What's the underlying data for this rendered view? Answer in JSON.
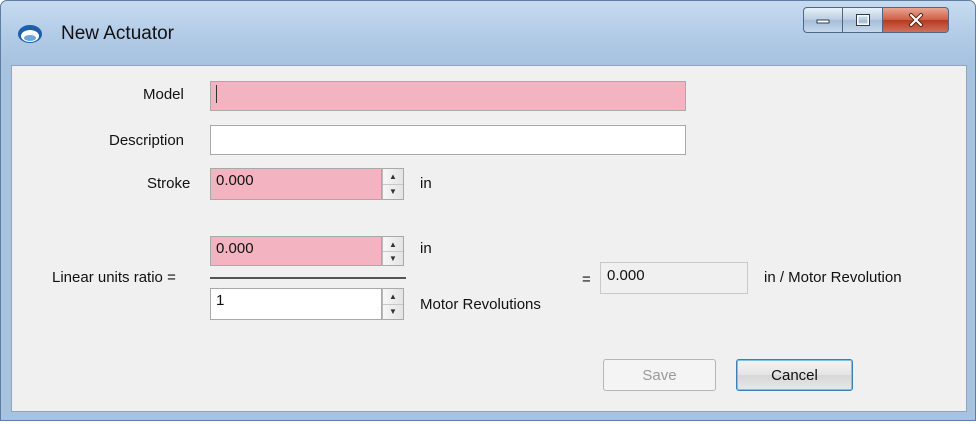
{
  "window": {
    "title": "New Actuator",
    "controls": {
      "minimize": "minimize-icon",
      "maximize": "maximize-icon",
      "close": "close-icon"
    }
  },
  "form": {
    "model": {
      "label": "Model",
      "value": ""
    },
    "description": {
      "label": "Description",
      "value": ""
    },
    "stroke": {
      "label": "Stroke",
      "value": "0.000",
      "unit": "in"
    },
    "ratio": {
      "label": "Linear units ratio =",
      "numerator": {
        "value": "0.000",
        "unit": "in"
      },
      "denominator": {
        "value": "1",
        "unit": "Motor Revolutions"
      },
      "equals": "=",
      "result": {
        "value": "0.000",
        "unit": "in / Motor Revolution"
      }
    }
  },
  "buttons": {
    "save": "Save",
    "cancel": "Cancel"
  },
  "colors": {
    "required_field": "#f4b3c0",
    "title_bar": "#b4cde8",
    "close_button": "#cf5d45"
  }
}
